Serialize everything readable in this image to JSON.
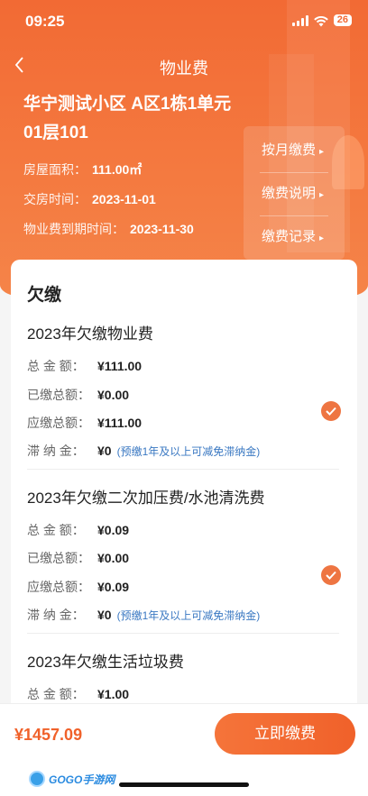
{
  "status": {
    "time": "09:25",
    "battery": "26"
  },
  "nav": {
    "title": "物业费"
  },
  "property": {
    "community": "华宁测试小区 A区1栋1单元01层101",
    "area_label": "房屋面积：",
    "area_value": "111.00㎡",
    "handover_label": "交房时间：",
    "handover_value": "2023-11-01",
    "expire_label": "物业费到期时间：",
    "expire_value": "2023-11-30"
  },
  "actions": [
    {
      "label": "按月缴费"
    },
    {
      "label": "缴费说明"
    },
    {
      "label": "缴费记录"
    }
  ],
  "arrears": {
    "title": "欠缴",
    "labels": {
      "total": "总 金 额：",
      "paid": "已缴总额：",
      "due": "应缴总额：",
      "late": "滞 纳 金："
    },
    "late_note": "(预缴1年及以上可减免滞纳金)",
    "items": [
      {
        "name": "2023年欠缴物业费",
        "total": "¥111.00",
        "paid": "¥0.00",
        "due": "¥111.00",
        "late": "¥0",
        "checked": true
      },
      {
        "name": "2023年欠缴二次加压费/水池清洗费",
        "total": "¥0.09",
        "paid": "¥0.00",
        "due": "¥0.09",
        "late": "¥0",
        "checked": true
      },
      {
        "name": "2023年欠缴生活垃圾费",
        "total": "¥1.00"
      }
    ]
  },
  "footer": {
    "total": "¥1457.09",
    "pay_button": "立即缴费",
    "watermark": "GOGO手游网"
  },
  "colors": {
    "brand": "#f26a34",
    "note": "#3a78c2"
  }
}
